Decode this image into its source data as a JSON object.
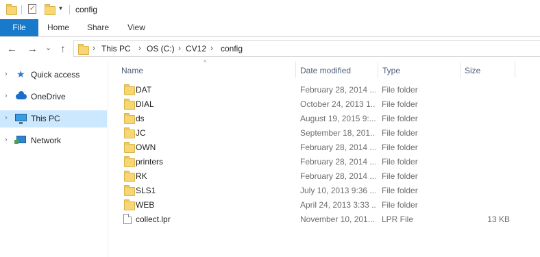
{
  "window": {
    "title": "config"
  },
  "ribbon": {
    "tabs": [
      "File",
      "Home",
      "Share",
      "View"
    ]
  },
  "address": {
    "path": [
      "This PC",
      "OS (C:)",
      "CV12",
      "config"
    ],
    "separator": "›"
  },
  "nav_glyphs": {
    "back": "←",
    "forward": "→",
    "recent": "⌄",
    "up": "↑",
    "expand": "›",
    "qat_dropdown": "▾",
    "sort": "^"
  },
  "nav_pane": {
    "items": [
      {
        "label": "Quick access",
        "icon": "star-icon",
        "selected": false
      },
      {
        "label": "OneDrive",
        "icon": "cloud-icon",
        "selected": false
      },
      {
        "label": "This PC",
        "icon": "computer-icon",
        "selected": true
      },
      {
        "label": "Network",
        "icon": "network-icon",
        "selected": false
      }
    ]
  },
  "columns": {
    "name": "Name",
    "date": "Date modified",
    "type": "Type",
    "size": "Size"
  },
  "files": [
    {
      "name": "DAT",
      "date": "February 28, 2014 ...",
      "type": "File folder",
      "size": "",
      "kind": "folder"
    },
    {
      "name": "DIAL",
      "date": "October 24, 2013 1...",
      "type": "File folder",
      "size": "",
      "kind": "folder"
    },
    {
      "name": "ds",
      "date": "August 19, 2015 9:...",
      "type": "File folder",
      "size": "",
      "kind": "folder"
    },
    {
      "name": "JC",
      "date": "September 18, 201...",
      "type": "File folder",
      "size": "",
      "kind": "folder"
    },
    {
      "name": "OWN",
      "date": "February 28, 2014 ...",
      "type": "File folder",
      "size": "",
      "kind": "folder"
    },
    {
      "name": "printers",
      "date": "February 28, 2014 ...",
      "type": "File folder",
      "size": "",
      "kind": "folder"
    },
    {
      "name": "RK",
      "date": "February 28, 2014 ...",
      "type": "File folder",
      "size": "",
      "kind": "folder"
    },
    {
      "name": "SLS1",
      "date": "July 10, 2013 9:36 ...",
      "type": "File folder",
      "size": "",
      "kind": "folder"
    },
    {
      "name": "WEB",
      "date": "April 24, 2013 3:33 ...",
      "type": "File folder",
      "size": "",
      "kind": "folder"
    },
    {
      "name": "collect.lpr",
      "date": "November 10, 201...",
      "type": "LPR File",
      "size": "13 KB",
      "kind": "file"
    }
  ],
  "colors": {
    "accent": "#1979ca",
    "selected": "#cce8ff",
    "folder": "#f7d774"
  }
}
